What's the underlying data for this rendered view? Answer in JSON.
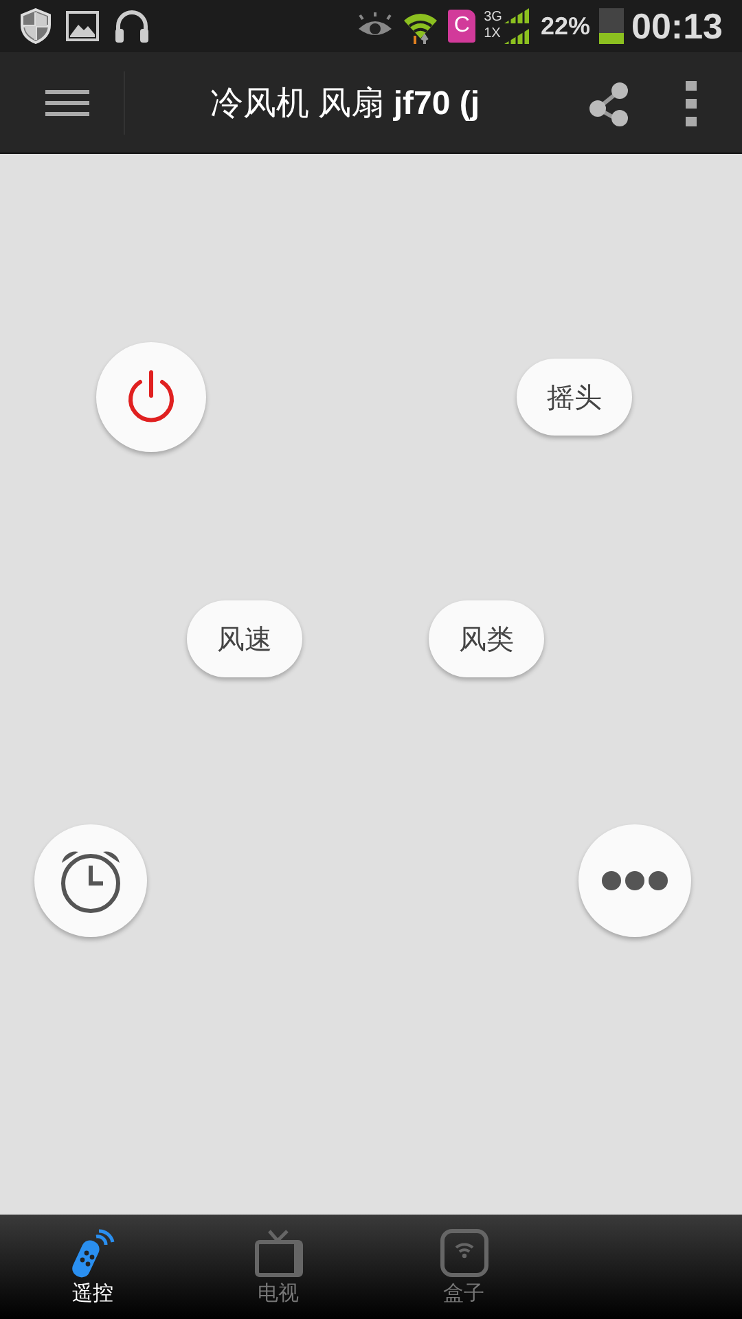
{
  "status_bar": {
    "sim_label": "C",
    "network": [
      "3G",
      "1X"
    ],
    "battery": "22%",
    "time": "00:13"
  },
  "app_bar": {
    "title": "冷风机 风扇 **jf70 (j**"
  },
  "remote_rows": [
    {
      "buttons": [
        {
          "kind": "power"
        },
        {
          "kind": "text",
          "label": "摇头"
        }
      ]
    },
    {
      "buttons": [
        {
          "kind": "text",
          "label": "风速"
        },
        {
          "kind": "text",
          "label": "风类"
        }
      ]
    },
    {
      "buttons": [
        {
          "kind": "timer"
        },
        {
          "kind": "more"
        }
      ]
    }
  ],
  "tabs": [
    {
      "label": "遥控",
      "kind": "remote",
      "selected": true
    },
    {
      "label": "电视",
      "kind": "tv",
      "selected": false
    },
    {
      "label": "盒子",
      "kind": "box",
      "selected": false
    }
  ]
}
